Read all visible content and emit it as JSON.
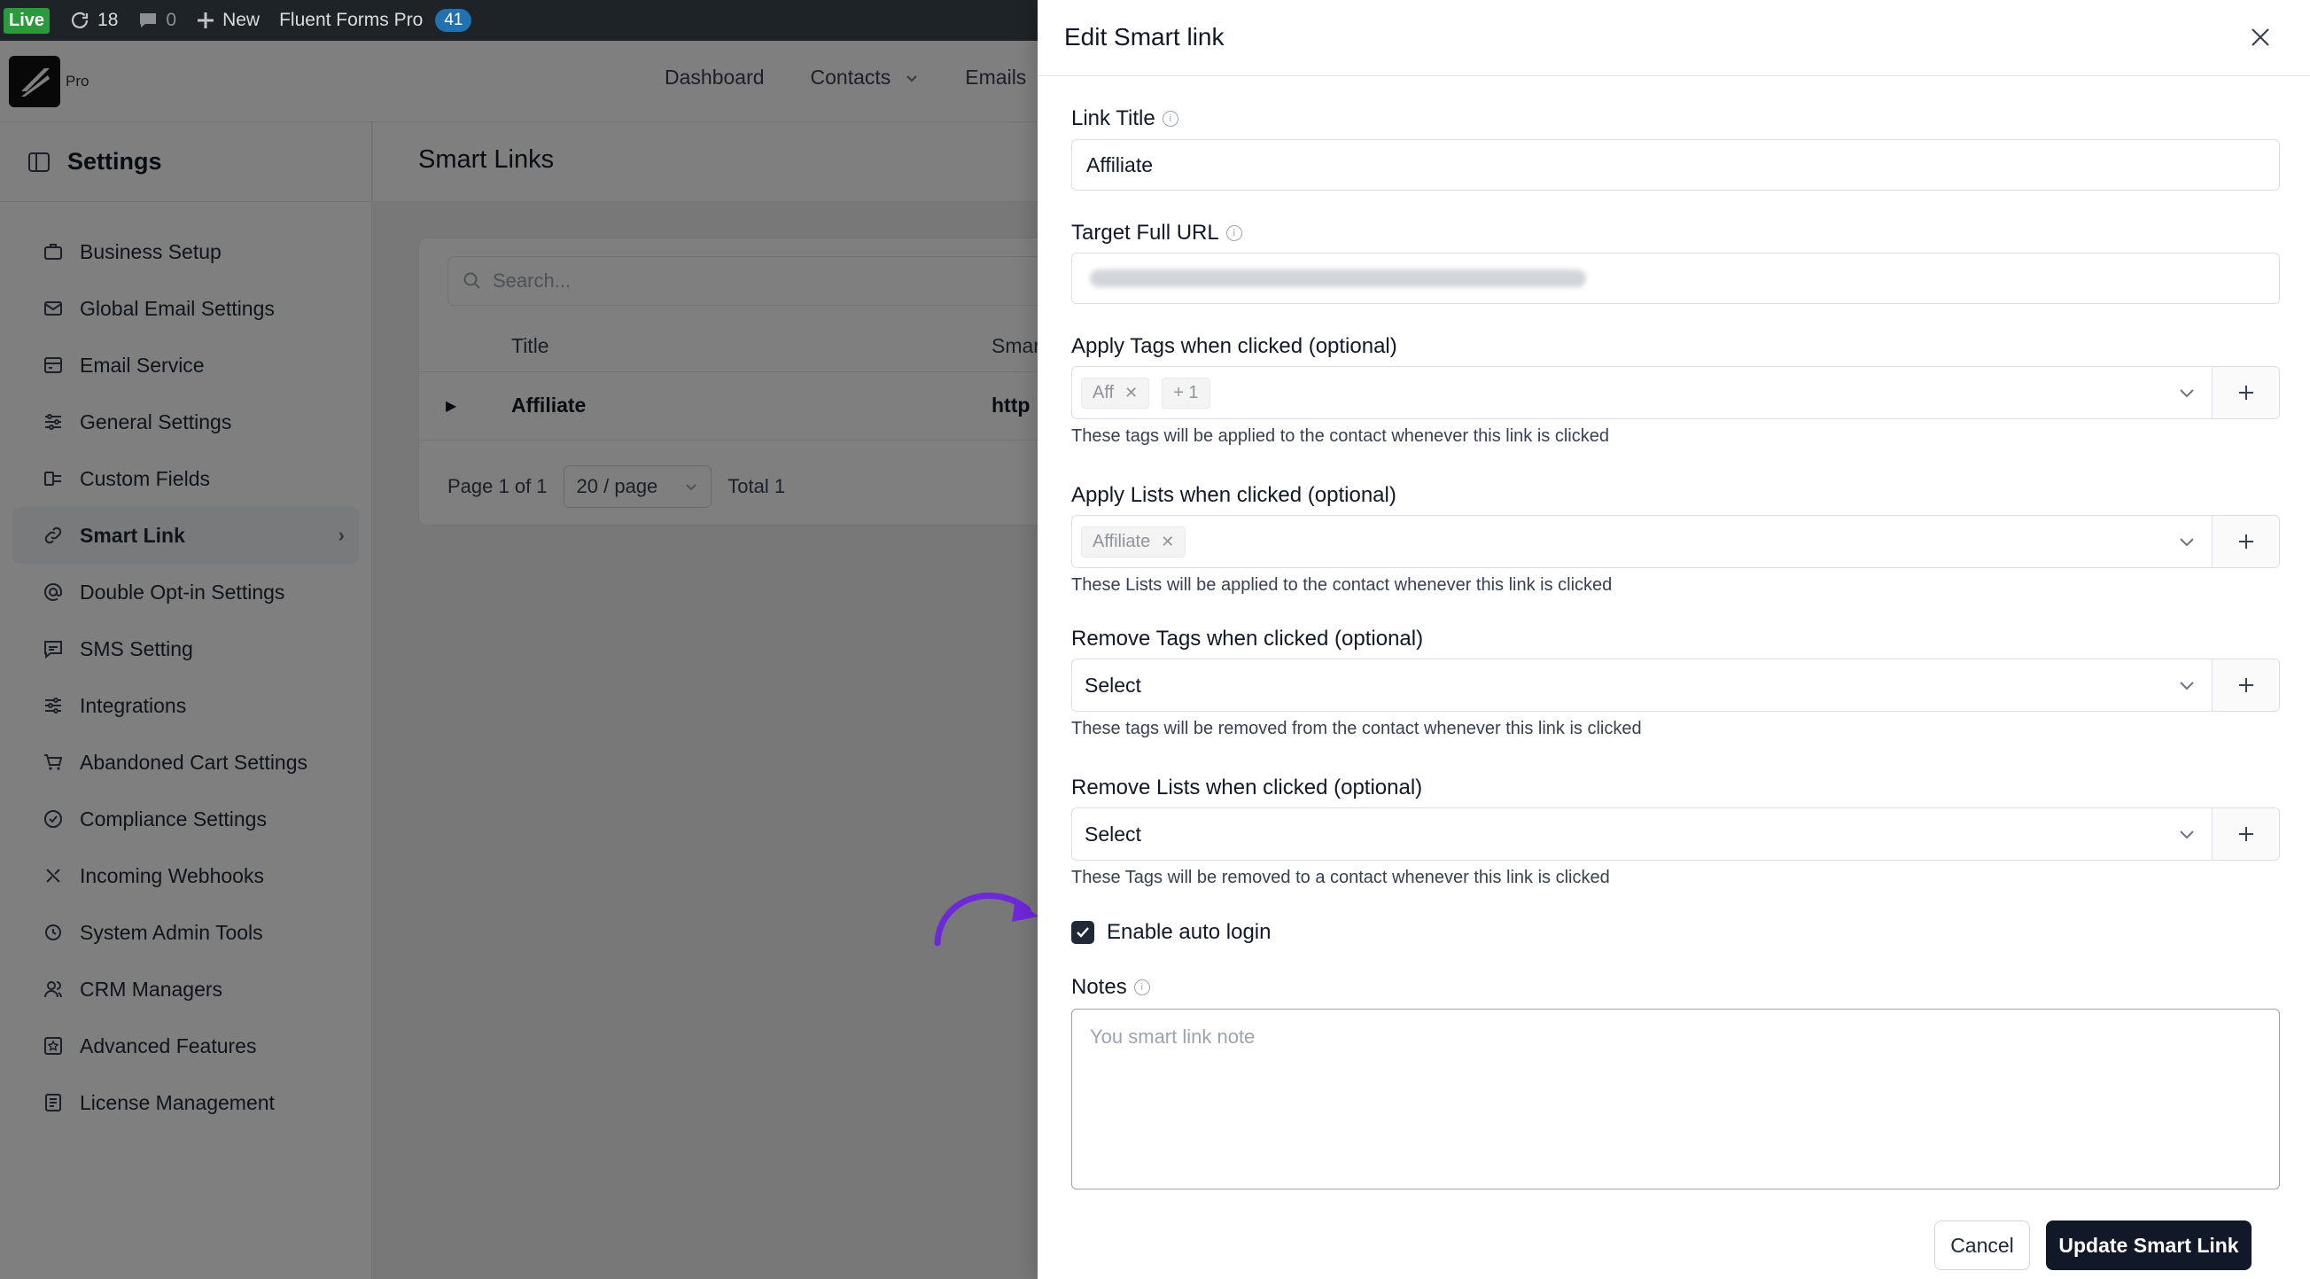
{
  "admin_bar": {
    "live_label": "Live",
    "updates_count": "18",
    "comments_count": "0",
    "new_label": "New",
    "plugin_label": "Fluent Forms Pro",
    "plugin_count": "41"
  },
  "brand": {
    "pro_label": "Pro"
  },
  "nav": {
    "items": [
      "Dashboard",
      "Contacts",
      "Emails"
    ]
  },
  "sidebar": {
    "title": "Settings",
    "items": [
      {
        "label": "Business Setup",
        "icon": "briefcase-icon"
      },
      {
        "label": "Global Email Settings",
        "icon": "mail-icon"
      },
      {
        "label": "Email Service",
        "icon": "server-icon"
      },
      {
        "label": "General Settings",
        "icon": "sliders-icon"
      },
      {
        "label": "Custom Fields",
        "icon": "fields-icon"
      },
      {
        "label": "Smart Link",
        "icon": "link-icon",
        "active": true
      },
      {
        "label": "Double Opt-in Settings",
        "icon": "at-icon"
      },
      {
        "label": "SMS Setting",
        "icon": "sms-icon"
      },
      {
        "label": "Integrations",
        "icon": "integrations-icon"
      },
      {
        "label": "Abandoned Cart Settings",
        "icon": "cart-icon"
      },
      {
        "label": "Compliance Settings",
        "icon": "check-circle-icon"
      },
      {
        "label": "Incoming Webhooks",
        "icon": "webhook-icon"
      },
      {
        "label": "System Admin Tools",
        "icon": "tools-icon"
      },
      {
        "label": "CRM Managers",
        "icon": "users-icon"
      },
      {
        "label": "Advanced Features",
        "icon": "star-box-icon"
      },
      {
        "label": "License Management",
        "icon": "license-icon"
      }
    ]
  },
  "main": {
    "title": "Smart Links",
    "search_placeholder": "Search...",
    "columns": [
      "Title",
      "Smar"
    ],
    "rows": [
      {
        "title": "Affiliate",
        "url": "http"
      }
    ],
    "pagination": {
      "page_label": "Page 1 of 1",
      "page_size": "20 / page",
      "total": "Total 1"
    }
  },
  "drawer": {
    "title": "Edit Smart link",
    "link_title_label": "Link Title",
    "link_title_value": "Affiliate",
    "target_url_label": "Target Full URL",
    "apply_tags_label": "Apply Tags when clicked (optional)",
    "apply_tags": [
      "Aff"
    ],
    "apply_tags_more": "+ 1",
    "apply_tags_help": "These tags will be applied to the contact whenever this link is clicked",
    "apply_lists_label": "Apply Lists when clicked (optional)",
    "apply_lists": [
      "Affiliate"
    ],
    "apply_lists_help": "These Lists will be applied to the contact whenever this link is clicked",
    "remove_tags_label": "Remove Tags when clicked (optional)",
    "remove_tags_placeholder": "Select",
    "remove_tags_help": "These tags will be removed from the contact whenever this link is clicked",
    "remove_lists_label": "Remove Lists when clicked (optional)",
    "remove_lists_placeholder": "Select",
    "remove_lists_help": "These Tags will be removed to a contact whenever this link is clicked",
    "auto_login_label": "Enable auto login",
    "auto_login_checked": true,
    "notes_label": "Notes",
    "notes_placeholder": "You smart link note",
    "cancel_label": "Cancel",
    "update_label": "Update Smart Link"
  },
  "colors": {
    "accent": "#111827",
    "annotation_arrow": "#6d28d9",
    "live_badge": "#2a9a3c",
    "count_badge": "#2271b1"
  }
}
